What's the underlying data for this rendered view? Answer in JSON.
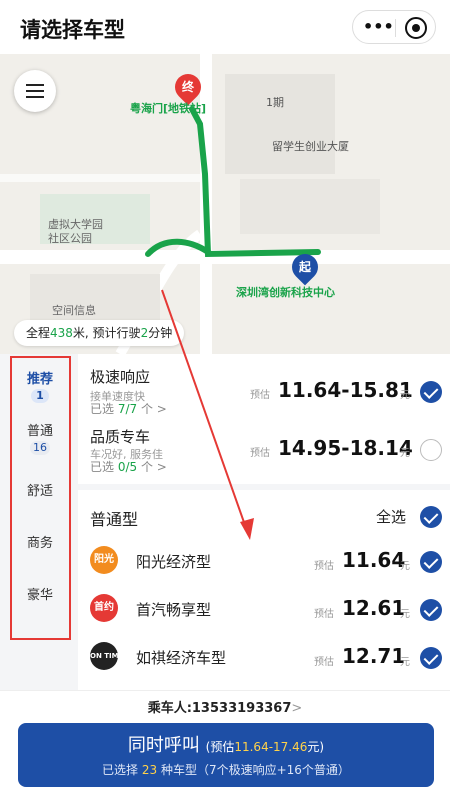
{
  "header": {
    "title": "请选择车型",
    "more_icon": "more-dots-icon",
    "close_icon": "target-close-icon",
    "more_glyph": "•••"
  },
  "map": {
    "menu_icon": "hamburger-menu-icon",
    "end_pin": "终",
    "start_pin": "起",
    "labels": {
      "end_station": "粤海门[地铁站]",
      "phase1": "1期",
      "building": "留学生创业大厦",
      "park": "虚拟大学园\n社区公园",
      "park_l1": "虚拟大学园",
      "park_l2": "社区公园",
      "start_place": "深圳湾创新科技中心",
      "space_info": "空间信息"
    },
    "summary": {
      "prefix": "全程",
      "distance": "438",
      "mid": "米, 预计行驶",
      "minutes": "2",
      "suffix": "分钟"
    },
    "colors": {
      "route": "#1aa34a",
      "end_pin": "#e53935",
      "start_pin": "#1e4fa6"
    }
  },
  "categories": [
    {
      "label": "推荐",
      "badge": "1",
      "active": true
    },
    {
      "label": "普通",
      "badge": "16",
      "active": false
    },
    {
      "label": "舒适",
      "badge": "",
      "active": false
    },
    {
      "label": "商务",
      "badge": "",
      "active": false
    },
    {
      "label": "豪华",
      "badge": "",
      "active": false
    }
  ],
  "groups": {
    "fast": {
      "title": "极速响应",
      "sub": "接单速度快",
      "sel_prefix": "已选 ",
      "sel_count": "7/7",
      "sel_suffix": " 个 >",
      "est": "预估",
      "price": "11.64-15.81",
      "unit": "元",
      "checked": true
    },
    "premium": {
      "title": "品质专车",
      "sub": "车况好, 服务佳",
      "sel_prefix": "已选 ",
      "sel_count": "0/5",
      "sel_suffix": " 个 >",
      "est": "预估",
      "price": "14.95-18.14",
      "unit": "元",
      "checked": false
    },
    "normal": {
      "title": "普通型",
      "select_all": "全选",
      "checked": true
    }
  },
  "providers": [
    {
      "logo": "阳光",
      "name": "阳光经济型",
      "est": "预估",
      "price": "11.64",
      "unit": "元",
      "color": "#f28c1f",
      "checked": true
    },
    {
      "logo": "首约",
      "name": "首汽畅享型",
      "est": "预估",
      "price": "12.61",
      "unit": "元",
      "color": "#e53935",
      "checked": true
    },
    {
      "logo": "ON TIME",
      "name": "如祺经济车型",
      "est": "预估",
      "price": "12.71",
      "unit": "元",
      "color": "#222222",
      "checked": true
    }
  ],
  "footer": {
    "passenger_label": "乘车人:",
    "passenger_phone": "13533193367",
    "chevron": ">",
    "call_label": "同时呼叫",
    "call_est_prefix": "(预估",
    "call_est_range": "11.64-17.46",
    "call_est_suffix": "元)",
    "selected_prefix": "已选择 ",
    "selected_count": "23",
    "selected_suffix": " 种车型（7个极速响应+16个普通）"
  },
  "colors": {
    "accent": "#1e4fa6",
    "green": "#1aa34a",
    "annotation_red": "#e53935"
  }
}
